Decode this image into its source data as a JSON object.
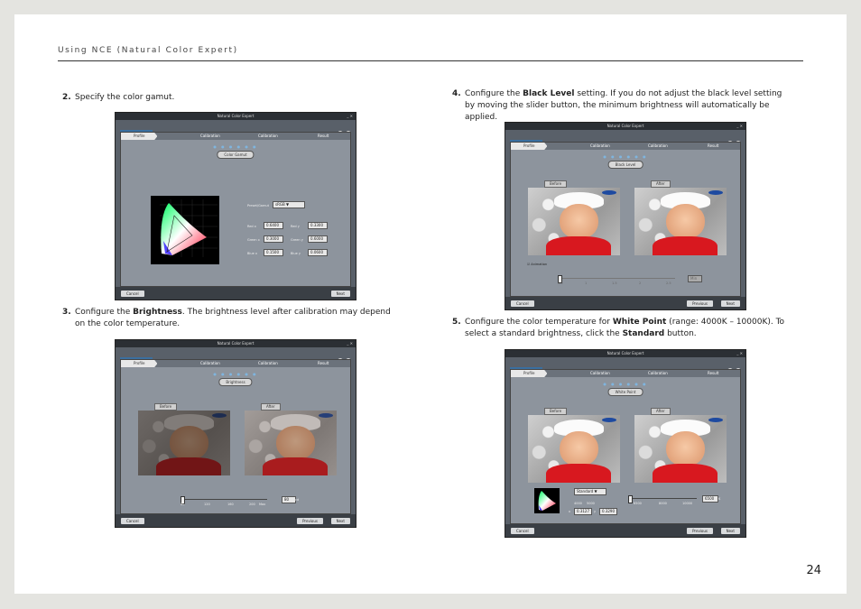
{
  "header": {
    "title": "Using NCE (Natural Color Expert)"
  },
  "page_number": "24",
  "steps": [
    {
      "num": "2.",
      "parts": [
        "Specify the color gamut."
      ]
    },
    {
      "num": "3.",
      "parts": [
        "Configure the ",
        "Brightness",
        ". The brightness level after calibration may depend on the color temperature."
      ]
    },
    {
      "num": "4.",
      "parts": [
        "Configure the ",
        "Black Level",
        " setting.  If you do not adjust the black level setting by moving the slider button, the minimum brightness will automatically be applied."
      ]
    },
    {
      "num": "5.",
      "parts": [
        "Configure the color temperature for ",
        "White Point",
        " (range: 4000K – 10000K).  To select a standard brightness, click the ",
        "Standard",
        " button."
      ]
    }
  ],
  "window": {
    "title": "Natural Color Expert",
    "tabs": [
      "Calibration",
      "Uniformity",
      "Verification"
    ],
    "steps": [
      "Profile",
      "Calibration",
      "Calibration",
      "Result"
    ],
    "dots": "● ● ● ● ● ●",
    "cancel": "Cancel",
    "next": "Next",
    "previous": "Previous",
    "before": "Before",
    "after": "After"
  },
  "screens": {
    "gamut": {
      "pill": "Color Gamut",
      "preset_label": "Preset/Gamut",
      "preset_value": "sRGB",
      "rows": [
        {
          "l1": "Red x",
          "v1": "0.6400",
          "l2": "Red y",
          "v2": "0.3300"
        },
        {
          "l1": "Green x",
          "v1": "0.3000",
          "l2": "Green y",
          "v2": "0.6000"
        },
        {
          "l1": "Blue x",
          "v1": "0.1500",
          "l2": "Blue y",
          "v2": "0.0600"
        }
      ]
    },
    "brightness": {
      "pill": "Brightness",
      "value": "80",
      "unit": "cd",
      "ticks": [
        "80",
        "120",
        "160",
        "200",
        "Max"
      ]
    },
    "black": {
      "pill": "Black Level",
      "animation": "Animation",
      "ticks": [
        "0.5",
        "1",
        "1.5",
        "2",
        "2.5"
      ],
      "value": "Min"
    },
    "white": {
      "pill": "White Point",
      "standard": "Standard",
      "value": "6500",
      "unit": "K",
      "x_label": "x",
      "x_value": "0.3127",
      "y_label": "y",
      "y_value": "0.3290",
      "ticks": [
        "4000",
        "5000",
        "6500",
        "8000",
        "10000"
      ]
    }
  }
}
